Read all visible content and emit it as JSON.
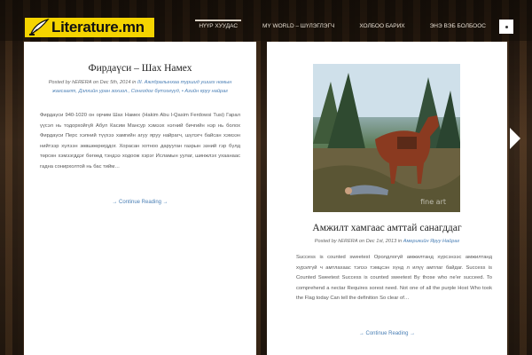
{
  "header": {
    "logo_text": "Literature.mn",
    "nav": [
      "НҮҮР ХУУДАС",
      "MY WORLD – ШҮЛЭГЛЭГЧ",
      "ХОЛБОО БАРИХ",
      "ЭНЭ ВЭБ БОЛБООС"
    ],
    "active_index": 0
  },
  "post_left": {
    "title": "Фирдаүси – Шах Намех",
    "meta_prefix": "Posted by ",
    "author": "hERERA",
    "meta_on": " on ",
    "date": "Dec 5th, 2014",
    "meta_in": " in ",
    "categories": "III. Ажлдралынхаа туршид ушигх номын жагсаалт, Дэлхийн уран зохиол., Сонгодог бүтээгүүд, • Азийн яруу найраг",
    "excerpt": "Фирдаүси 940-1020 он орчим Шах Намех (Hakim Abu l-Qasim Ferdowsi Tusi) Гарал үүсэл нь тодорхойгүй Абул Касим Мансур хэмээх нэгний бичгийн нэр нь болох Фирдаүси Перс хэлний түүхээ хамгийн агуу яруу найрагч, шүлэгч байсан хэмээн нийтээр хүлээн зөвшөөрөгддог. Хорасан хотноо дарууган газрын эзний гэр бүлд төрсөн хэмээгддэг бөгөөд тэндээ ходоож хэрэг Исламын уулаг, шинжлэх ухаанаас гадна сонирхолтой нь бас тийм…",
    "more_label": "→ Continue Reading →"
  },
  "post_right": {
    "title": "Амжилт хамгаас амттай санагддаг",
    "meta_prefix": "Posted by ",
    "author": "hERERA",
    "meta_on": " on ",
    "date": "Dec 1st, 2013",
    "meta_in": " in ",
    "categories": "Америкийн Яруу Найраг",
    "excerpt": "Success is counted sweetest Оролдлогүй амжилтанд хүрсэнээс амжилтанд хүрэлгүй ч амтлахаас тэлээ тэмцсэн хүнд л илүү амтлаг байдаг.    Success is Counted Sweetest Success is counted sweetest By those who ne'er succeed. To comprehend a nectar Requires sorest need. Not one of all the purple Host Who took the Flag today Can tell the definition So clear of…",
    "more_label": "→ Continue Reading →",
    "watermark": "fine art"
  },
  "colors": {
    "logo_bg": "#f5d400",
    "link": "#4a7fb5"
  }
}
